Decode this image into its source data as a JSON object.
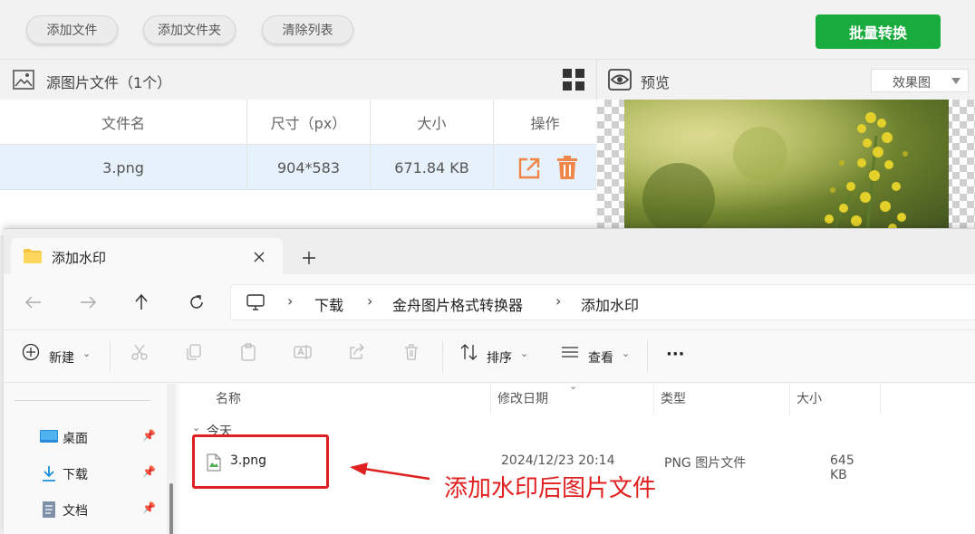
{
  "toolbar": {
    "add_file": "添加文件",
    "add_folder": "添加文件夹",
    "clear_list": "清除列表",
    "batch_convert": "批量转换"
  },
  "source": {
    "title": "源图片文件（1个）"
  },
  "preview": {
    "title": "预览",
    "mode": "效果图"
  },
  "table": {
    "headers": [
      "文件名",
      "尺寸（px）",
      "大小",
      "操作"
    ],
    "rows": [
      {
        "name": "3.png",
        "dimensions": "904*583",
        "size": "671.84 KB"
      }
    ]
  },
  "explorer": {
    "tab_title": "添加水印",
    "breadcrumb": [
      "下载",
      "金舟图片格式转换器",
      "添加水印"
    ],
    "commands": {
      "new": "新建",
      "sort": "排序",
      "view": "查看"
    },
    "nav": [
      "桌面",
      "下载",
      "文档"
    ],
    "columns": [
      "名称",
      "修改日期",
      "类型",
      "大小"
    ],
    "group": "今天",
    "files": [
      {
        "name": "3.png",
        "modified": "2024/12/23 20:14",
        "type": "PNG 图片文件",
        "size": "645 KB"
      }
    ]
  },
  "annotation": "添加水印后图片文件",
  "colors": {
    "accent_green": "#1aab3e",
    "annotation_red": "#e02020",
    "action_orange": "#f0874a"
  }
}
